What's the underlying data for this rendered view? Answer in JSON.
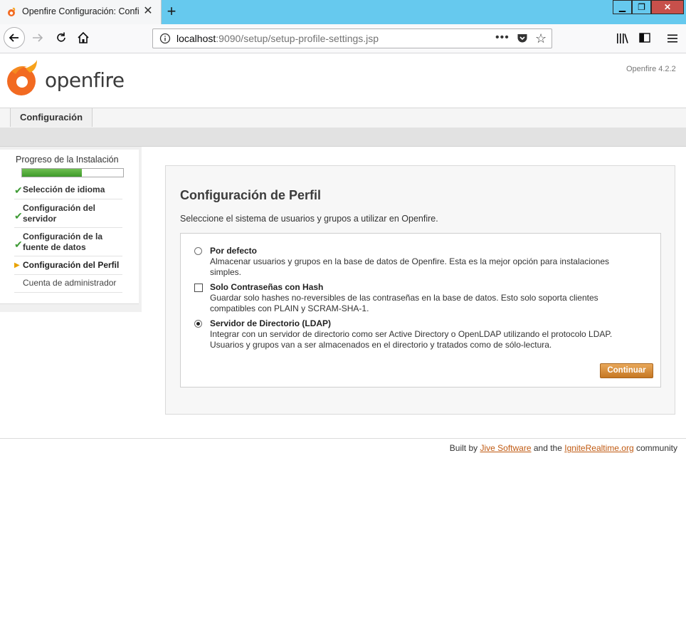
{
  "browser": {
    "tab_title": "Openfire Configuración: Configuración de Perfil",
    "url_host": "localhost",
    "url_rest": ":9090/setup/setup-profile-settings.jsp",
    "url_more": "•••"
  },
  "header": {
    "logo_text": "openfire",
    "logo_tm": "™",
    "version": "Openfire 4.2.2",
    "tab_label": "Configuración"
  },
  "sidebar": {
    "progress_label": "Progreso de la Instalación",
    "progress_fraction": 0.59,
    "steps": [
      {
        "label": "Selección de idioma",
        "status": "done"
      },
      {
        "label": "Configuración del servidor",
        "status": "done"
      },
      {
        "label": "Configuración de la fuente de datos",
        "status": "done"
      },
      {
        "label": "Configuración del Perfil",
        "status": "current"
      },
      {
        "label": "Cuenta de administrador",
        "status": "todo"
      }
    ]
  },
  "main": {
    "title": "Configuración de Perfil",
    "description": "Seleccione el sistema de usuarios y grupos a utilizar en Openfire.",
    "options": [
      {
        "title": "Por defecto",
        "desc": "Almacenar usuarios y grupos en la base de datos de Openfire. Esta es la mejor opción para instalaciones simples.",
        "control": "radio",
        "selected": false
      },
      {
        "title": "Solo Contraseñas con Hash",
        "desc": "Guardar solo hashes no-reversibles de las contraseñas en la base de datos. Esto solo soporta clientes compatibles con PLAIN y SCRAM-SHA-1.",
        "control": "checkbox",
        "selected": false
      },
      {
        "title": "Servidor de Directorio (LDAP)",
        "desc": "Integrar con un servidor de directorio como ser Active Directory o OpenLDAP utilizando el protocolo LDAP. Usuarios y grupos van a ser almacenados en el directorio y tratados como de sólo-lectura.",
        "control": "radio",
        "selected": true
      }
    ],
    "continue_label": "Continuar"
  },
  "footer": {
    "built_by": "Built by",
    "jive_link": "Jive Software",
    "and_the": "and the",
    "ignite_link": "IgniteRealtime.org",
    "community": "community"
  },
  "colors": {
    "accent_orange": "#c57723",
    "progress_green": "#3e9a2a",
    "titlebar_blue": "#66c9ee"
  }
}
